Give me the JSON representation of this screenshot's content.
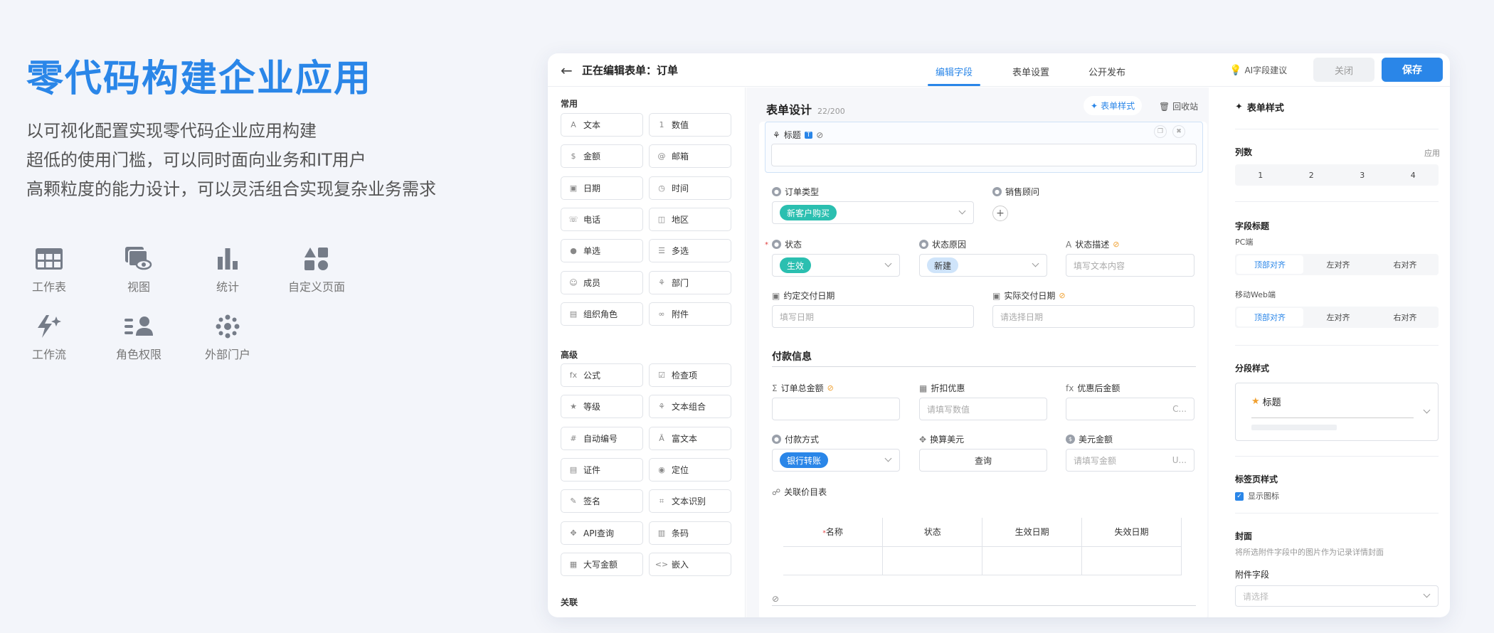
{
  "hero": {
    "title": "零代码构建企业应用",
    "lines": [
      "以可视化配置实现零代码企业应用构建",
      "超低的使用门槛，可以同时面向业务和IT用户",
      "高颗粒度的能力设计，可以灵活组合实现复杂业务需求"
    ],
    "features": [
      {
        "label": "工作表",
        "icon": "table-icon"
      },
      {
        "label": "视图",
        "icon": "view-icon"
      },
      {
        "label": "统计",
        "icon": "bar-chart-icon"
      },
      {
        "label": "自定义页面",
        "icon": "shapes-icon"
      },
      {
        "label": "工作流",
        "icon": "bolt-icon"
      },
      {
        "label": "角色权限",
        "icon": "users-icon"
      },
      {
        "label": "外部门户",
        "icon": "portal-icon"
      }
    ]
  },
  "app": {
    "title": "正在编辑表单：订单",
    "tabs": [
      "编辑字段",
      "表单设置",
      "公开发布"
    ],
    "active_tab": "编辑字段",
    "ai_label": "AI字段建议",
    "close_label": "关闭",
    "save_label": "保存",
    "accent": "#2a86e8"
  },
  "palette": {
    "common_title": "常用",
    "common": [
      [
        "文本",
        "数值"
      ],
      [
        "金额",
        "邮箱"
      ],
      [
        "日期",
        "时间"
      ],
      [
        "电话",
        "地区"
      ],
      [
        "单选",
        "多选"
      ],
      [
        "成员",
        "部门"
      ],
      [
        "组织角色",
        "附件"
      ]
    ],
    "advanced_title": "高级",
    "advanced": [
      [
        "公式",
        "检查项"
      ],
      [
        "等级",
        "文本组合"
      ],
      [
        "自动编号",
        "富文本"
      ],
      [
        "证件",
        "定位"
      ],
      [
        "签名",
        "文本识别"
      ],
      [
        "API查询",
        "条码"
      ],
      [
        "大写金额",
        "嵌入"
      ]
    ],
    "relation_title": "关联"
  },
  "form": {
    "heading": "表单设计",
    "count": "22/200",
    "style_btn": "表单样式",
    "recycle": "回收站",
    "title_field": "标题",
    "order_type": {
      "label": "订单类型",
      "value": "新客户购买",
      "color": "#2bbfb0"
    },
    "sales": {
      "label": "销售顾问"
    },
    "status": {
      "label": "状态",
      "value": "生效",
      "color": "#2bbfb0"
    },
    "status_reason": {
      "label": "状态原因",
      "value": "新建"
    },
    "status_desc": {
      "label": "状态描述",
      "placeholder": "填写文本内容"
    },
    "agreed_date": {
      "label": "约定交付日期",
      "placeholder": "填写日期"
    },
    "actual_date": {
      "label": "实际交付日期",
      "placeholder": "请选择日期"
    },
    "payment_group": "付款信息",
    "total": {
      "label": "订单总金额"
    },
    "discount": {
      "label": "折扣优惠",
      "placeholder": "请填写数值"
    },
    "after": {
      "label": "优惠后金额",
      "suffix": "C..."
    },
    "pay_method": {
      "label": "付款方式",
      "value": "银行转账",
      "color": "#2a86e8"
    },
    "convert": {
      "label": "换算美元",
      "button": "查询"
    },
    "usd": {
      "label": "美元金额",
      "placeholder": "请填写金额",
      "suffix": "U..."
    },
    "price_list": {
      "label": "关联价目表",
      "columns": [
        "名称",
        "状态",
        "生效日期",
        "失效日期"
      ]
    }
  },
  "props": {
    "title": "表单样式",
    "columns_label": "列数",
    "apply": "应用",
    "columns": [
      "1",
      "2",
      "3",
      "4"
    ],
    "field_title": "字段标题",
    "pc": "PC端",
    "mobile": "移动Web端",
    "align": [
      "顶部对齐",
      "左对齐",
      "右对齐"
    ],
    "section_style": "分段样式",
    "section_sample": "标题",
    "tab_style": "标签页样式",
    "show_icon": "显示图标",
    "cover": "封面",
    "cover_desc": "将所选附件字段中的图片作为记录详情封面",
    "attach_field": "附件字段",
    "attach_placeholder": "请选择"
  }
}
